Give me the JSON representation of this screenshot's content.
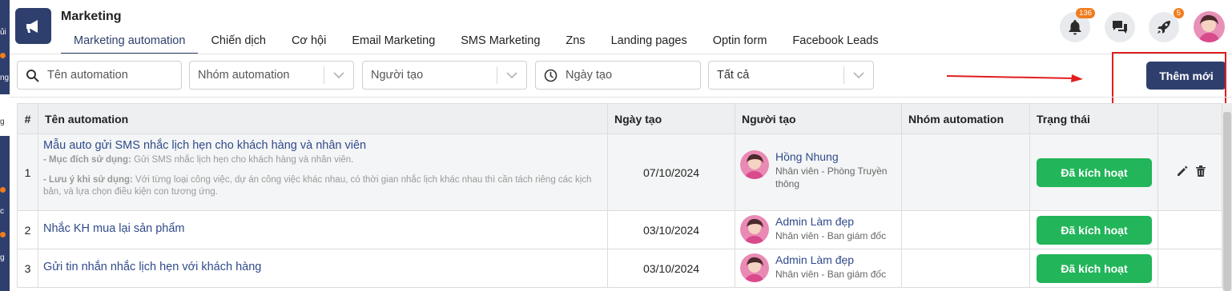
{
  "app": {
    "title": "Marketing",
    "icon": "megaphone-icon"
  },
  "left_sidebar": {
    "fragments": [
      "ủi",
      "ng",
      "g",
      "c",
      "g"
    ]
  },
  "tabs": [
    {
      "label": "Marketing automation",
      "active": true
    },
    {
      "label": "Chiến dịch",
      "active": false
    },
    {
      "label": "Cơ hội",
      "active": false
    },
    {
      "label": "Email Marketing",
      "active": false
    },
    {
      "label": "SMS Marketing",
      "active": false
    },
    {
      "label": "Zns",
      "active": false
    },
    {
      "label": "Landing pages",
      "active": false
    },
    {
      "label": "Optin form",
      "active": false
    },
    {
      "label": "Facebook Leads",
      "active": false
    }
  ],
  "header_actions": {
    "notifications_badge": "136",
    "rocket_badge": "5"
  },
  "filters": {
    "name_placeholder": "Tên automation",
    "group_placeholder": "Nhóm automation",
    "creator_placeholder": "Người tạo",
    "date_placeholder": "Ngày tạo",
    "status_value": "Tất cả"
  },
  "add_button_label": "Thêm mới",
  "table": {
    "headers": [
      "#",
      "Tên automation",
      "Ngày tạo",
      "Người tạo",
      "Nhóm automation",
      "Trạng thái"
    ],
    "rows": [
      {
        "index": "1",
        "name": "Mẫu auto gửi SMS nhắc lịch hẹn cho khách hàng và nhân viên",
        "purpose_label": "- Mục đích sử dụng:",
        "purpose_text": " Gửi SMS nhắc lịch hẹn cho khách hàng và nhân viên.",
        "note_label": "- Lưu ý khi sử dụng:",
        "note_text": " Với từng loại công việc, dự án công việc khác nhau, có thời gian nhắc lịch khác nhau thì cần tách riêng các kịch bản, và lựa chọn điều kiện con tương ứng.",
        "date": "07/10/2024",
        "creator_name": "Hồng Nhung",
        "creator_role": "Nhân viên - Phòng Truyền thông",
        "group": "",
        "status": "Đã kích hoạt"
      },
      {
        "index": "2",
        "name": "Nhắc KH mua lại sản phẩm",
        "date": "03/10/2024",
        "creator_name": "Admin Làm đẹp",
        "creator_role": "Nhân viên - Ban giám đốc",
        "group": "",
        "status": "Đã kích hoạt"
      },
      {
        "index": "3",
        "name": "Gửi tin nhắn nhắc lịch hẹn với khách hàng",
        "date": "03/10/2024",
        "creator_name": "Admin Làm đẹp",
        "creator_role": "Nhân viên - Ban giám đốc",
        "group": "",
        "status": "Đã kích hoạt"
      }
    ]
  },
  "colors": {
    "brand": "#2f3f6d",
    "active_status": "#22b559",
    "badge": "#f07c1e",
    "annotation": "#e01e1e",
    "link": "#2f4a8a"
  }
}
